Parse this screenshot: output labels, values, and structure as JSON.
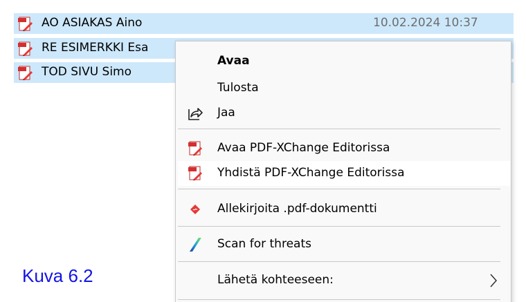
{
  "files": [
    {
      "name": "AO ASIAKAS Aino",
      "date": "10.02.2024 10:37",
      "icon": "pdf-file-icon"
    },
    {
      "name": "RE ESIMERKKI Esa",
      "date": "",
      "icon": "pdf-file-icon"
    },
    {
      "name": "TOD SIVU Simo",
      "date": "",
      "icon": "pdf-file-icon"
    }
  ],
  "context_menu": {
    "items": [
      {
        "label": "Avaa",
        "icon": "",
        "bold": true
      },
      {
        "label": "Tulosta",
        "icon": ""
      },
      {
        "label": "Jaa",
        "icon": "share-icon"
      },
      {
        "label": "Avaa PDF-XChange Editorissa",
        "icon": "pdf-xchange-icon"
      },
      {
        "label": "Yhdistä PDF-XChange Editorissa",
        "icon": "pdf-xchange-icon",
        "highlighted": true
      },
      {
        "label": "Allekirjoita .pdf-dokumentti",
        "icon": "sign-icon"
      },
      {
        "label": "Scan for threats",
        "icon": "antivirus-icon"
      },
      {
        "label": "Lähetä kohteeseen:",
        "icon": "",
        "submenu": true
      }
    ]
  },
  "caption": "Kuva 6.2",
  "colors": {
    "selection_bg": "#cde8fb",
    "menu_bg": "#f9f9f9",
    "menu_hover_bg": "#ffffff",
    "caption_text": "#1414e6",
    "date_text": "#6d6d6d"
  }
}
